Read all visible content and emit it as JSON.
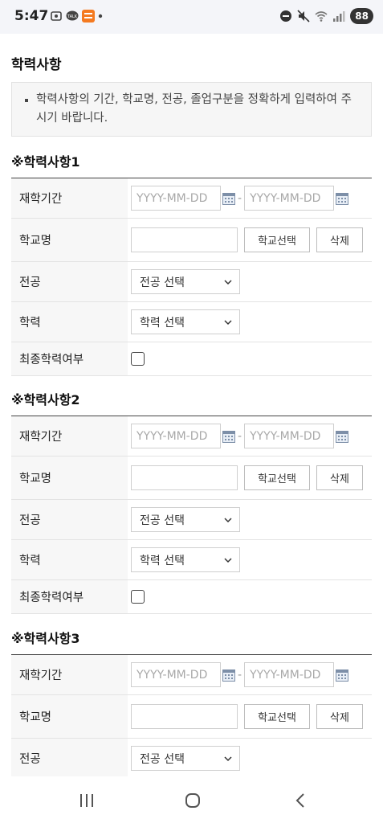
{
  "status_bar": {
    "time": "5:47",
    "talk_label": "TALK",
    "battery": "88"
  },
  "page": {
    "title": "학력사항",
    "notice": "학력사항의 기간, 학교명, 전공, 졸업구분을 정확하게 입력하여 주시기 바랍니다."
  },
  "sections": [
    {
      "title": "※학력사항1",
      "period_label": "재학기간",
      "start_placeholder": "YYYY-MM-DD",
      "range_sep": "-",
      "end_placeholder": "YYYY-MM-DD",
      "school_label": "학교명",
      "school_select_button": "학교선택",
      "delete_button": "삭제",
      "major_label": "전공",
      "major_select": "전공 선택",
      "degree_label": "학력",
      "degree_select": "학력 선택",
      "final_label": "최종학력여부"
    },
    {
      "title": "※학력사항2",
      "period_label": "재학기간",
      "start_placeholder": "YYYY-MM-DD",
      "range_sep": "-",
      "end_placeholder": "YYYY-MM-DD",
      "school_label": "학교명",
      "school_select_button": "학교선택",
      "delete_button": "삭제",
      "major_label": "전공",
      "major_select": "전공 선택",
      "degree_label": "학력",
      "degree_select": "학력 선택",
      "final_label": "최종학력여부"
    },
    {
      "title": "※학력사항3",
      "period_label": "재학기간",
      "start_placeholder": "YYYY-MM-DD",
      "range_sep": "-",
      "end_placeholder": "YYYY-MM-DD",
      "school_label": "학교명",
      "school_select_button": "학교선택",
      "delete_button": "삭제",
      "major_label": "전공",
      "major_select": "전공 선택"
    }
  ],
  "icons": {
    "calendar": "calendar-icon",
    "chevron": "chevron-down-icon",
    "recents": "recent-apps-icon",
    "home": "home-icon",
    "back": "back-icon"
  }
}
